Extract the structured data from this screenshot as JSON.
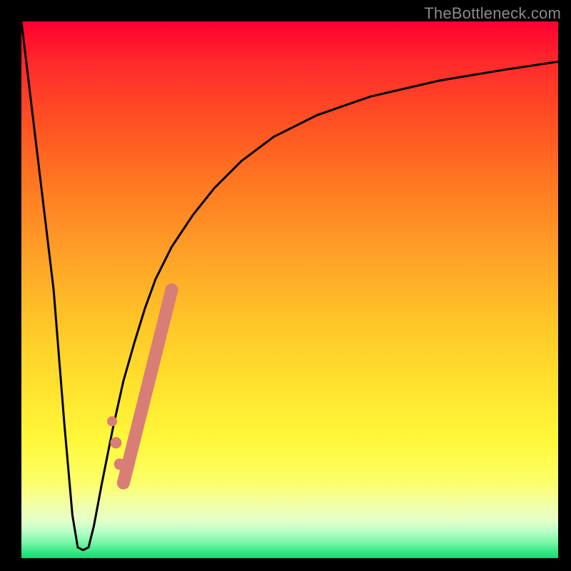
{
  "watermark": "TheBottleneck.com",
  "colors": {
    "curve": "#000000",
    "highlight": "#d97d77",
    "frame": "#000000"
  },
  "chart_data": {
    "type": "line",
    "title": "",
    "xlabel": "",
    "ylabel": "",
    "xlim": [
      0,
      100
    ],
    "ylim": [
      0,
      100
    ],
    "grid": false,
    "legend": false,
    "series": [
      {
        "name": "bottleneck_curve",
        "x": [
          0,
          3,
          6,
          8,
          9.5,
          10.5,
          11.5,
          12.5,
          13.5,
          15,
          17,
          19,
          21,
          23,
          25,
          28,
          32,
          36,
          41,
          47,
          55,
          65,
          78,
          90,
          100
        ],
        "y": [
          100,
          75,
          50,
          25,
          8,
          2,
          1.5,
          2,
          6,
          14,
          24,
          33,
          40,
          46.5,
          52,
          58,
          64,
          69,
          74,
          78.5,
          82.5,
          86,
          89,
          91,
          92.5
        ]
      }
    ],
    "highlight_segment": {
      "description": "thick salmon overlay on the rising branch",
      "x": [
        19,
        20,
        21,
        22,
        23,
        24,
        25,
        26,
        27,
        28
      ],
      "y": [
        14,
        18,
        22,
        26,
        30,
        34,
        38,
        42,
        46,
        50
      ]
    },
    "highlight_dots": {
      "x": [
        18.3,
        17.6,
        16.9
      ],
      "y": [
        17.5,
        21.5,
        25.5
      ],
      "r": [
        8,
        8,
        7
      ]
    }
  }
}
